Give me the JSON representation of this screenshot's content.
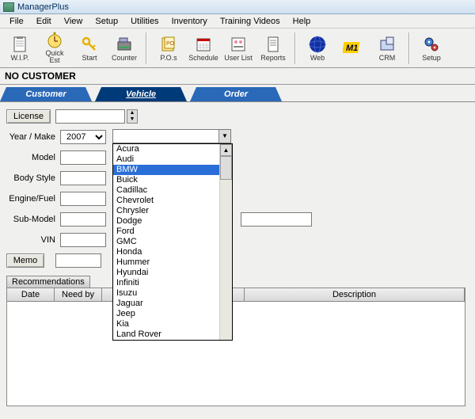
{
  "window": {
    "title": "ManagerPlus"
  },
  "menu": [
    "File",
    "Edit",
    "View",
    "Setup",
    "Utilities",
    "Inventory",
    "Training Videos",
    "Help"
  ],
  "toolbar": [
    {
      "label": "W.I.P.",
      "icon": "clipboard"
    },
    {
      "label": "Quick Est",
      "icon": "clock"
    },
    {
      "label": "Start",
      "icon": "key"
    },
    {
      "label": "Counter",
      "icon": "register"
    },
    {
      "label": "P.O.s",
      "icon": "po"
    },
    {
      "label": "Schedule",
      "icon": "calendar"
    },
    {
      "label": "User List",
      "icon": "users"
    },
    {
      "label": "Reports",
      "icon": "report"
    },
    {
      "label": "Web",
      "icon": "globe"
    },
    {
      "label": "",
      "icon": "m1"
    },
    {
      "label": "CRM",
      "icon": "crm"
    },
    {
      "label": "Setup",
      "icon": "gear"
    }
  ],
  "status": "NO CUSTOMER",
  "tabs": {
    "customer": "Customer",
    "vehicle": "Vehicle",
    "order": "Order"
  },
  "form": {
    "license": {
      "label": "License",
      "value": ""
    },
    "yearmake": {
      "label": "Year / Make",
      "year": "2007",
      "make": ""
    },
    "model": {
      "label": "Model",
      "value": ""
    },
    "bodystyle": {
      "label": "Body Style",
      "value": ""
    },
    "enginefuel": {
      "label": "Engine/Fuel",
      "value": ""
    },
    "submodel": {
      "label": "Sub-Model",
      "value": ""
    },
    "vin": {
      "label": "VIN",
      "value": ""
    },
    "memo": {
      "label": "Memo",
      "value": ""
    }
  },
  "makeDropdown": {
    "items": [
      "Acura",
      "Audi",
      "BMW",
      "Buick",
      "Cadillac",
      "Chevrolet",
      "Chrysler",
      "Dodge",
      "Ford",
      "GMC",
      "Honda",
      "Hummer",
      "Hyundai",
      "Infiniti",
      "Isuzu",
      "Jaguar",
      "Jeep",
      "Kia",
      "Land Rover"
    ],
    "selectedIndex": 2
  },
  "rec": {
    "header": "Recommendations",
    "cols": {
      "date": "Date",
      "needby": "Need by",
      "desc": "Description"
    }
  }
}
